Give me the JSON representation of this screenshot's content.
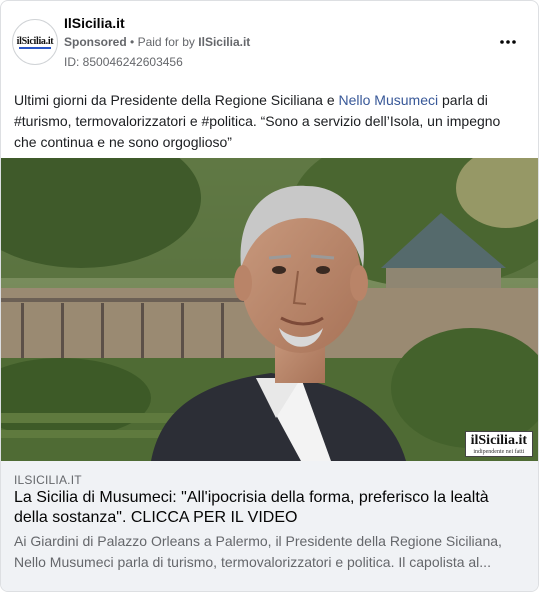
{
  "post": {
    "page_name": "IlSicilia.it",
    "sponsored_label": "Sponsored",
    "meta_separator": "•",
    "paid_for_prefix": "Paid for by",
    "paid_for_by": "IlSicilia.it",
    "ad_id": "ID: 850046242603456",
    "more_icon": "more-horizontal-icon",
    "avatar_logo_text": "ilSicilia.it"
  },
  "body": {
    "text_before": "Ultimi giorni da Presidente della Regione Siciliana e ",
    "link_text": "Nello Musumeci",
    "text_after": " parla di #turismo, termovalorizzatori e #politica. “Sono a servizio dell’Isola, un impegno che continua e ne sono orgoglioso”"
  },
  "media": {
    "watermark_main": "ilSicilia.it",
    "watermark_sub": "indipendente nei fatti"
  },
  "link_preview": {
    "domain": "ILSICILIA.IT",
    "headline": "La Sicilia di Musumeci: \"All'ipocrisia della forma, preferisco la lealtà della sostanza\". CLICCA PER IL VIDEO",
    "description": "Ai Giardini di Palazzo Orleans a Palermo, il Presidente della Regione Siciliana, Nello Musumeci parla di turismo, termovalorizzatori e politica. Il capolista al..."
  }
}
